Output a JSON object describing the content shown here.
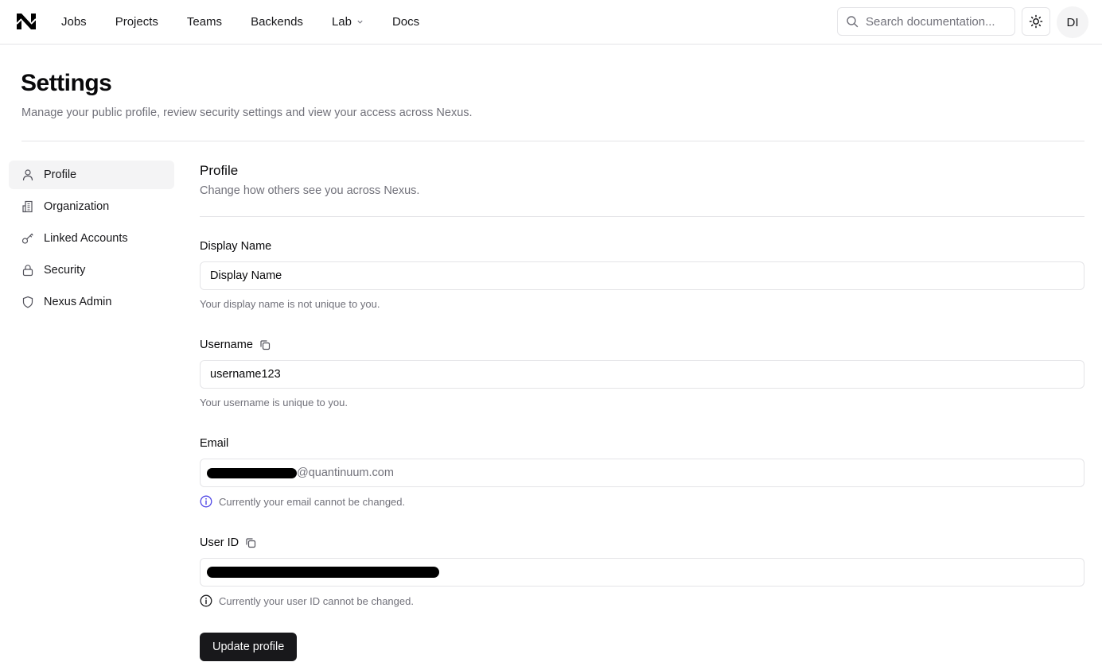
{
  "nav": {
    "logo": "nexus-logo",
    "items": [
      {
        "label": "Jobs"
      },
      {
        "label": "Projects"
      },
      {
        "label": "Teams"
      },
      {
        "label": "Backends"
      },
      {
        "label": "Lab",
        "has_dropdown": true
      },
      {
        "label": "Docs"
      }
    ],
    "search_placeholder": "Search documentation...",
    "theme_icon": "sun-icon",
    "avatar_initials": "DI"
  },
  "header": {
    "title": "Settings",
    "subtitle": "Manage your public profile, review security settings and view your access across Nexus."
  },
  "sidebar": {
    "items": [
      {
        "label": "Profile",
        "icon": "user-icon",
        "active": true
      },
      {
        "label": "Organization",
        "icon": "building-icon"
      },
      {
        "label": "Linked Accounts",
        "icon": "key-icon"
      },
      {
        "label": "Security",
        "icon": "lock-icon"
      },
      {
        "label": "Nexus Admin",
        "icon": "shield-icon"
      }
    ]
  },
  "profile": {
    "title": "Profile",
    "subtitle": "Change how others see you across Nexus.",
    "display_name": {
      "label": "Display Name",
      "value": "Display Name",
      "help": "Your display name is not unique to you."
    },
    "username": {
      "label": "Username",
      "value": "username123",
      "help": "Your username is unique to you."
    },
    "email": {
      "label": "Email",
      "value_suffix": "@quantinuum.com",
      "value_redacted": true,
      "help": "Currently your email cannot be changed."
    },
    "user_id": {
      "label": "User ID",
      "value_redacted": true,
      "help": "Currently your user ID cannot be changed."
    },
    "submit_label": "Update profile"
  },
  "colors": {
    "accent_info": "#4f46e5",
    "primary_button": "#18181b",
    "muted_text": "#71717a",
    "border": "#e4e4e7"
  }
}
